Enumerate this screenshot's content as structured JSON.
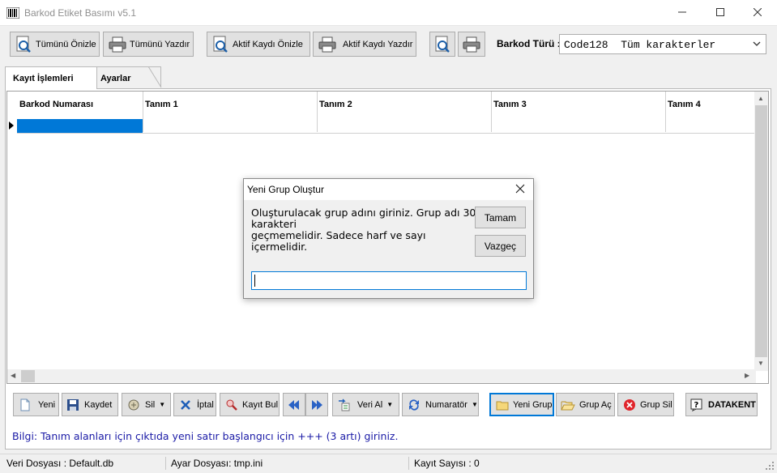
{
  "window": {
    "title": "Barkod Etiket Basımı  v5.1"
  },
  "toolbar": {
    "preview_all": "Tümünü Önizle",
    "print_all": "Tümünü Yazdır",
    "preview_active": "Aktif Kaydı Önizle",
    "print_active": "Aktif Kaydı Yazdır",
    "barcode_type_label": "Barkod Türü :",
    "barcode_type_value": "Code128  Tüm karakterler"
  },
  "tabs": [
    {
      "label": "Kayıt İşlemleri",
      "active": true
    },
    {
      "label": "Ayarlar",
      "active": false
    }
  ],
  "grid": {
    "columns": [
      "Barkod Numarası",
      "Tanım 1",
      "Tanım 2",
      "Tanım 3",
      "Tanım 4"
    ]
  },
  "dialog": {
    "title": "Yeni Grup Oluştur",
    "message_lines": [
      "Oluşturulacak grup adını giriniz. Grup adı 30",
      "karakteri",
      "geçmemelidir. Sadece harf ve sayı",
      "içermelidir."
    ],
    "ok": "Tamam",
    "cancel": "Vazgeç",
    "input_value": ""
  },
  "actions": {
    "new": "Yeni",
    "save": "Kaydet",
    "delete": "Sil",
    "cancel": "İptal",
    "find": "Kayıt Bul",
    "import": "Veri Al",
    "numerator": "Numaratör",
    "new_group": "Yeni Grup",
    "open_group": "Grup Aç",
    "delete_group": "Grup Sil",
    "datakent": "DATAKENT"
  },
  "info": "Bilgi: Tanım alanları için çıktıda yeni satır başlangıcı için +++ (3 artı) giriniz.",
  "status": {
    "data_file": "Veri Dosyası : Default.db",
    "settings_file": "Ayar Dosyası: tmp.ini",
    "record_count": "Kayıt Sayısı : 0"
  },
  "colors": {
    "accent": "#0078d7",
    "info_text": "#1a1aa6"
  }
}
